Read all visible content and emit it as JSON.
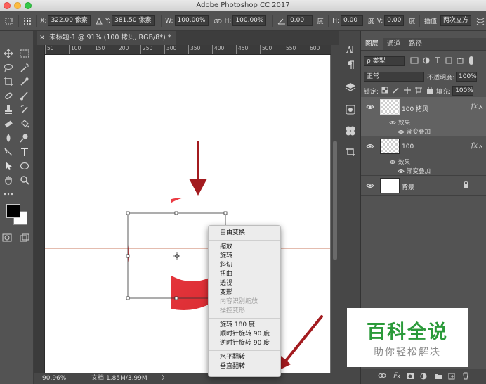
{
  "window": {
    "title": "Adobe Photoshop CC 2017"
  },
  "options_bar": {
    "x_label": "X:",
    "x_value": "322.00 像素",
    "y_label": "Y:",
    "y_value": "381.50 像素",
    "w_label": "W:",
    "w_value": "100.00%",
    "h_label": "H:",
    "h_value": "100.00%",
    "angle_value": "0.00",
    "angle_unit": "度",
    "hskew_label": "H:",
    "hskew_value": "0.00",
    "hskew_unit": "度",
    "vskew_label": "V:",
    "vskew_value": "0.00",
    "vskew_unit": "度",
    "interp_label": "插值:",
    "interp_value": "两次立方"
  },
  "document": {
    "tab_close": "×",
    "tab_title": "未标题-1 @ 91% (100 拷贝, RGB/8*) *",
    "ruler_marks": [
      "50",
      "100",
      "150",
      "200",
      "250",
      "300",
      "350",
      "400",
      "450",
      "500",
      "550",
      "600"
    ]
  },
  "status_bar": {
    "zoom": "90.96%",
    "doc_info": "文档:1.85M/3.99M",
    "arrow": "〉"
  },
  "context_menu": {
    "groups": [
      [
        "自由变换"
      ],
      [
        "缩放",
        "旋转",
        "斜切",
        "扭曲",
        "透视",
        "变形",
        "内容识别缩放",
        "操控变形"
      ],
      [
        "旋转 180 度",
        "顺时针旋转 90 度",
        "逆时针旋转 90 度"
      ],
      [
        "水平翻转",
        "垂直翻转"
      ]
    ],
    "disabled": [
      "内容识别缩放",
      "操控变形"
    ]
  },
  "layers_panel": {
    "tabs": [
      "图层",
      "通道",
      "路径"
    ],
    "filter_kind": "ρ 类型",
    "blend_mode": "正常",
    "opacity_label": "不透明度:",
    "opacity_value": "100%",
    "lock_label": "锁定:",
    "fill_label": "填充:",
    "fill_value": "100%",
    "layers": [
      {
        "name": "100 拷贝",
        "effects_label": "效果",
        "effect": "渐变叠加",
        "fx": "fx"
      },
      {
        "name": "100",
        "effects_label": "效果",
        "effect": "渐变叠加",
        "fx": "fx"
      },
      {
        "name": "背景"
      }
    ]
  },
  "watermark": {
    "title": "百科全说",
    "subtitle": "助你轻松解决"
  },
  "colors": {
    "crescent": "#e8333a",
    "arrow": "#a31b1f",
    "guide": "#c9785f",
    "menu_bg": "#ececec"
  }
}
